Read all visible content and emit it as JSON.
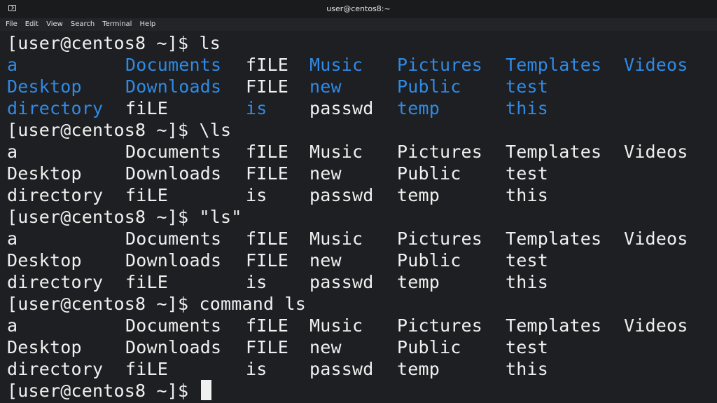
{
  "window": {
    "title": "user@centos8:~"
  },
  "menu": [
    "File",
    "Edit",
    "View",
    "Search",
    "Terminal",
    "Help"
  ],
  "prompt": "[user@centos8 ~]$",
  "colors": {
    "background": "#1e1f22",
    "text": "#f0f0f0",
    "directory": "#2f8ae6"
  },
  "blocks": [
    {
      "command": "ls",
      "colored": true,
      "rows": [
        [
          {
            "t": "a",
            "d": true
          },
          {
            "t": "Documents",
            "d": true
          },
          {
            "t": "fILE",
            "d": false
          },
          {
            "t": "Music",
            "d": true
          },
          {
            "t": "Pictures",
            "d": true
          },
          {
            "t": "Templates",
            "d": true
          },
          {
            "t": "Videos",
            "d": true
          }
        ],
        [
          {
            "t": "Desktop",
            "d": true
          },
          {
            "t": "Downloads",
            "d": true
          },
          {
            "t": "FILE",
            "d": false
          },
          {
            "t": "new",
            "d": true
          },
          {
            "t": "Public",
            "d": true
          },
          {
            "t": "test",
            "d": true
          }
        ],
        [
          {
            "t": "directory",
            "d": true
          },
          {
            "t": "fiLE",
            "d": false
          },
          {
            "t": "is",
            "d": true
          },
          {
            "t": "passwd",
            "d": false
          },
          {
            "t": "temp",
            "d": true
          },
          {
            "t": "this",
            "d": true
          }
        ]
      ]
    },
    {
      "command": "\\ls",
      "colored": false,
      "rows": [
        [
          {
            "t": "a"
          },
          {
            "t": "Documents"
          },
          {
            "t": "fILE"
          },
          {
            "t": "Music"
          },
          {
            "t": "Pictures"
          },
          {
            "t": "Templates"
          },
          {
            "t": "Videos"
          }
        ],
        [
          {
            "t": "Desktop"
          },
          {
            "t": "Downloads"
          },
          {
            "t": "FILE"
          },
          {
            "t": "new"
          },
          {
            "t": "Public"
          },
          {
            "t": "test"
          }
        ],
        [
          {
            "t": "directory"
          },
          {
            "t": "fiLE"
          },
          {
            "t": "is"
          },
          {
            "t": "passwd"
          },
          {
            "t": "temp"
          },
          {
            "t": "this"
          }
        ]
      ]
    },
    {
      "command": "\"ls\"",
      "colored": false,
      "rows": [
        [
          {
            "t": "a"
          },
          {
            "t": "Documents"
          },
          {
            "t": "fILE"
          },
          {
            "t": "Music"
          },
          {
            "t": "Pictures"
          },
          {
            "t": "Templates"
          },
          {
            "t": "Videos"
          }
        ],
        [
          {
            "t": "Desktop"
          },
          {
            "t": "Downloads"
          },
          {
            "t": "FILE"
          },
          {
            "t": "new"
          },
          {
            "t": "Public"
          },
          {
            "t": "test"
          }
        ],
        [
          {
            "t": "directory"
          },
          {
            "t": "fiLE"
          },
          {
            "t": "is"
          },
          {
            "t": "passwd"
          },
          {
            "t": "temp"
          },
          {
            "t": "this"
          }
        ]
      ]
    },
    {
      "command": "command ls",
      "colored": false,
      "rows": [
        [
          {
            "t": "a"
          },
          {
            "t": "Documents"
          },
          {
            "t": "fILE"
          },
          {
            "t": "Music"
          },
          {
            "t": "Pictures"
          },
          {
            "t": "Templates"
          },
          {
            "t": "Videos"
          }
        ],
        [
          {
            "t": "Desktop"
          },
          {
            "t": "Downloads"
          },
          {
            "t": "FILE"
          },
          {
            "t": "new"
          },
          {
            "t": "Public"
          },
          {
            "t": "test"
          }
        ],
        [
          {
            "t": "directory"
          },
          {
            "t": "fiLE"
          },
          {
            "t": "is"
          },
          {
            "t": "passwd"
          },
          {
            "t": "temp"
          },
          {
            "t": "this"
          }
        ]
      ]
    }
  ],
  "final_prompt": "[user@centos8 ~]$"
}
